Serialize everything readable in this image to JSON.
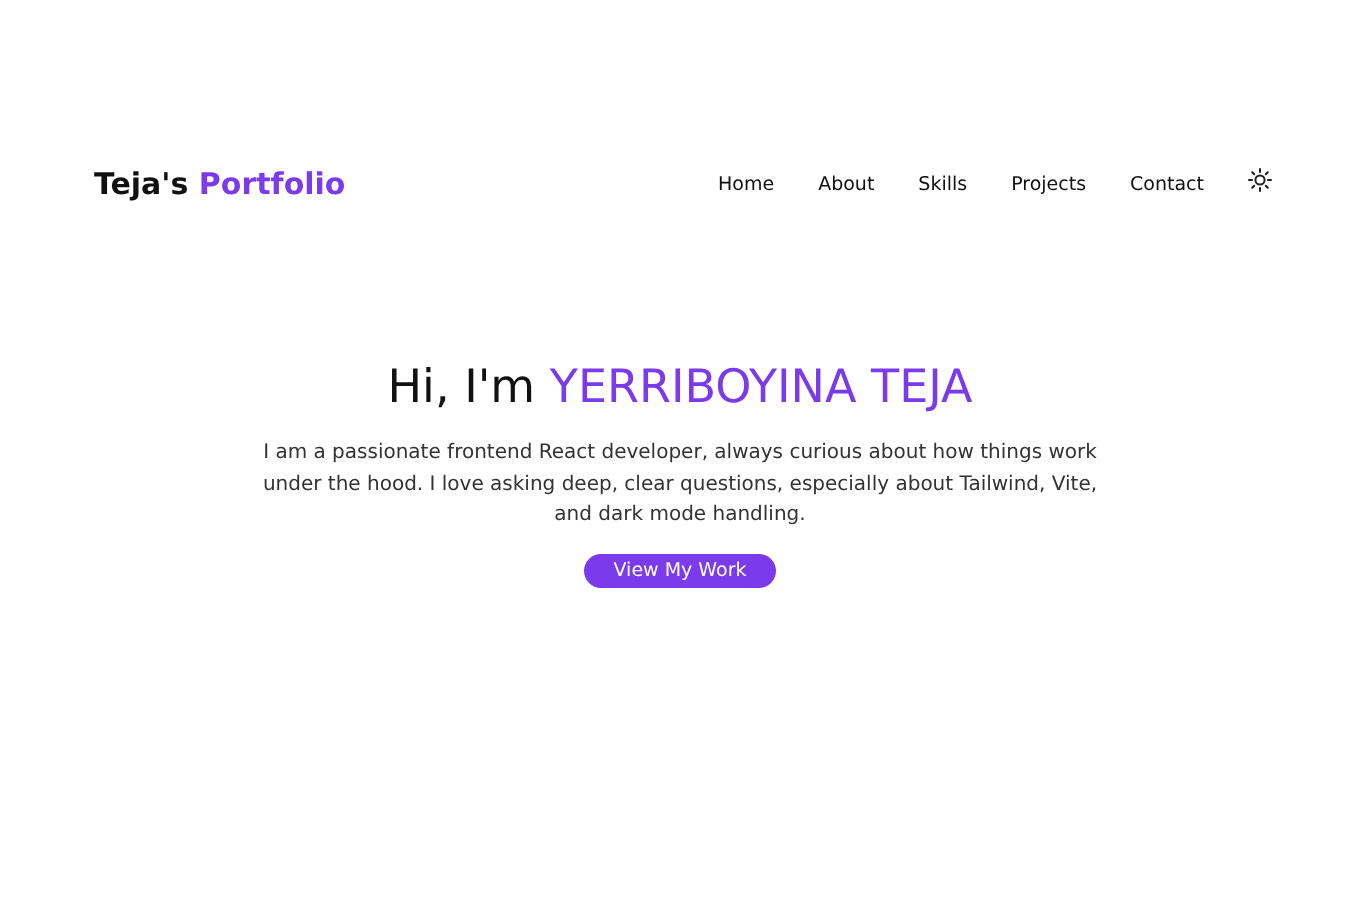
{
  "brand": {
    "text": "Teja's",
    "highlight": "Portfolio"
  },
  "nav": {
    "links": [
      {
        "label": "Home"
      },
      {
        "label": "About"
      },
      {
        "label": "Skills"
      },
      {
        "label": "Projects"
      },
      {
        "label": "Contact"
      }
    ]
  },
  "hero": {
    "greeting": "Hi, I'm",
    "name": "YERRIBOYINA TEJA",
    "description": "I am a passionate frontend React developer, always curious about how things work under the hood. I love asking deep, clear questions, especially about Tailwind, Vite, and dark mode handling.",
    "button": "View My Work"
  }
}
